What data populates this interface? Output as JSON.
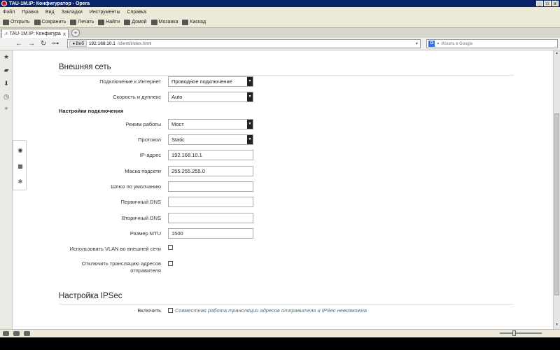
{
  "window": {
    "title": "TAU-1M.IP: Конфигуратор - Opera",
    "controls": [
      "_",
      "□",
      "x"
    ]
  },
  "menu": [
    "Файл",
    "Правка",
    "Вид",
    "Закладки",
    "Инструменты",
    "Справка"
  ],
  "toolbar": [
    {
      "label": "Открыть",
      "icon": "folder-icon"
    },
    {
      "label": "Сохранить",
      "icon": "save-icon"
    },
    {
      "label": "Печать",
      "icon": "print-icon"
    },
    {
      "label": "Найти",
      "icon": "find-icon"
    },
    {
      "label": "Домой",
      "icon": "home-icon"
    },
    {
      "label": "Мозаика",
      "icon": "tile-icon"
    },
    {
      "label": "Каскад",
      "icon": "cascade-icon"
    }
  ],
  "tab": {
    "title": "TAU-1M.IP: Конфигура...",
    "close": "x"
  },
  "address": {
    "badge": "Веб",
    "host": "192.168.10.1",
    "path": "/client/index.html",
    "dropdown": "▾"
  },
  "search": {
    "engine": "G",
    "placeholder": "Искать в Google"
  },
  "wan": {
    "title": "Внешняя сеть",
    "fields": {
      "internet_connection": {
        "label": "Подключение к Интернет",
        "value": "Проводное подключение"
      },
      "speed_duplex": {
        "label": "Скорость и дуплекс",
        "value": "Auto"
      }
    },
    "subheading": "Настройки подключения",
    "connection": {
      "mode": {
        "label": "Режим работы",
        "value": "Мост"
      },
      "protocol": {
        "label": "Протокол",
        "value": "Static"
      },
      "ip": {
        "label": "IP-адрес",
        "value": "192.168.10.1"
      },
      "mask": {
        "label": "Маска подсети",
        "value": "255.255.255.0"
      },
      "gateway": {
        "label": "Шлюз по умолчанию",
        "value": ""
      },
      "dns1": {
        "label": "Первичный DNS",
        "value": ""
      },
      "dns2": {
        "label": "Вторичный DNS",
        "value": ""
      },
      "mtu": {
        "label": "Размер MTU",
        "value": "1500"
      },
      "vlan": {
        "label": "Использовать VLAN во внешней сети",
        "checked": false
      },
      "nat": {
        "label": "Отключить трансляцию адресов отправителя",
        "checked": false
      }
    }
  },
  "ipsec": {
    "title": "Настройка IPSec",
    "enable_label": "Включить",
    "enabled": false,
    "note": "Совместная работа трансляции адресов отправителя и IPSec невозможна"
  },
  "zoom": {
    "level": 0.33
  }
}
